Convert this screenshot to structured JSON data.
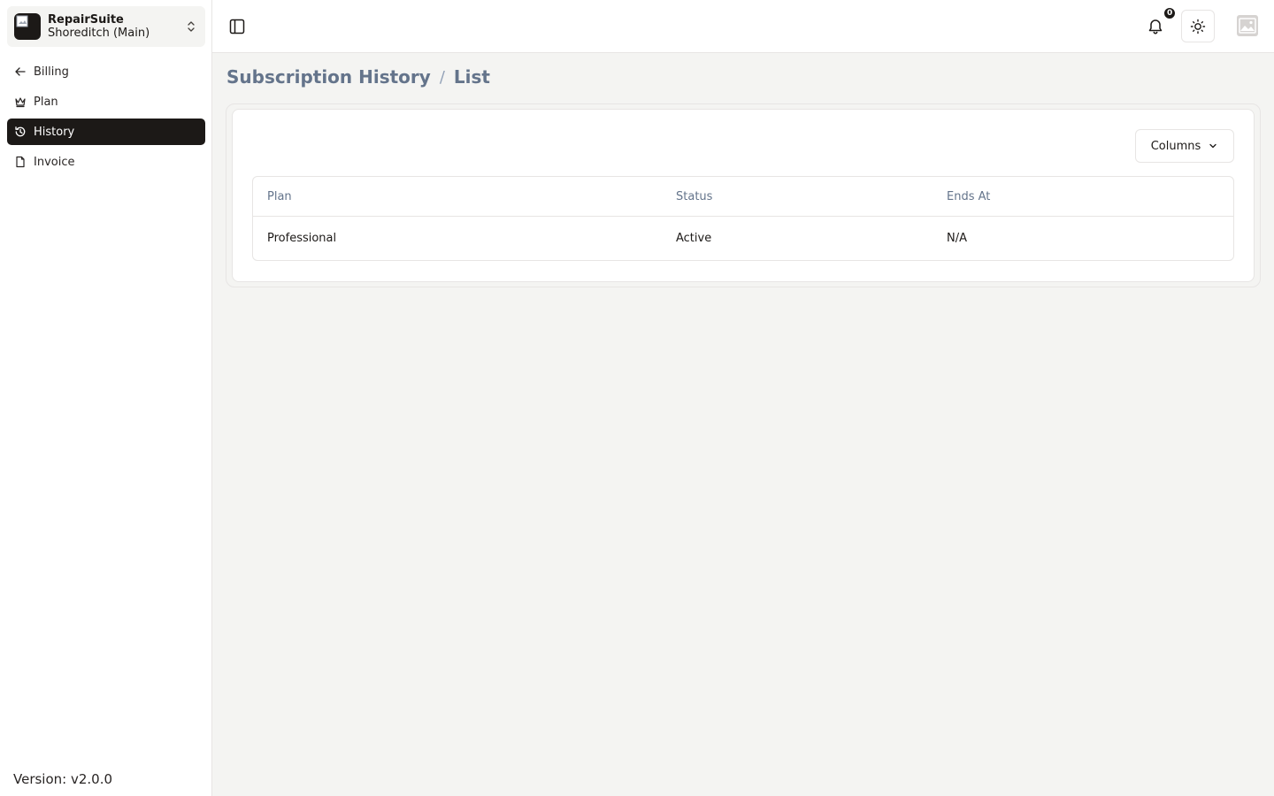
{
  "app": {
    "name": "RepairSuite",
    "branch": "Shoreditch (Main)",
    "version": "Version: v2.0.0"
  },
  "sidebar": {
    "items": [
      {
        "label": "Billing",
        "icon": "arrow-left-icon",
        "active": false
      },
      {
        "label": "Plan",
        "icon": "crown-icon",
        "active": false
      },
      {
        "label": "History",
        "icon": "history-icon",
        "active": true
      },
      {
        "label": "Invoice",
        "icon": "file-icon",
        "active": false
      }
    ]
  },
  "header": {
    "notification_count": "0"
  },
  "breadcrumb": {
    "title": "Subscription History",
    "separator": "/",
    "current": "List"
  },
  "toolbar": {
    "columns_label": "Columns"
  },
  "table": {
    "columns": [
      "Plan",
      "Status",
      "Ends At"
    ],
    "rows": [
      {
        "plan": "Professional",
        "status": "Active",
        "ends_at": "N/A"
      }
    ]
  },
  "colors": {
    "accent": "#1c1917",
    "background": "#f4f4f2",
    "muted_text": "#64748b"
  }
}
